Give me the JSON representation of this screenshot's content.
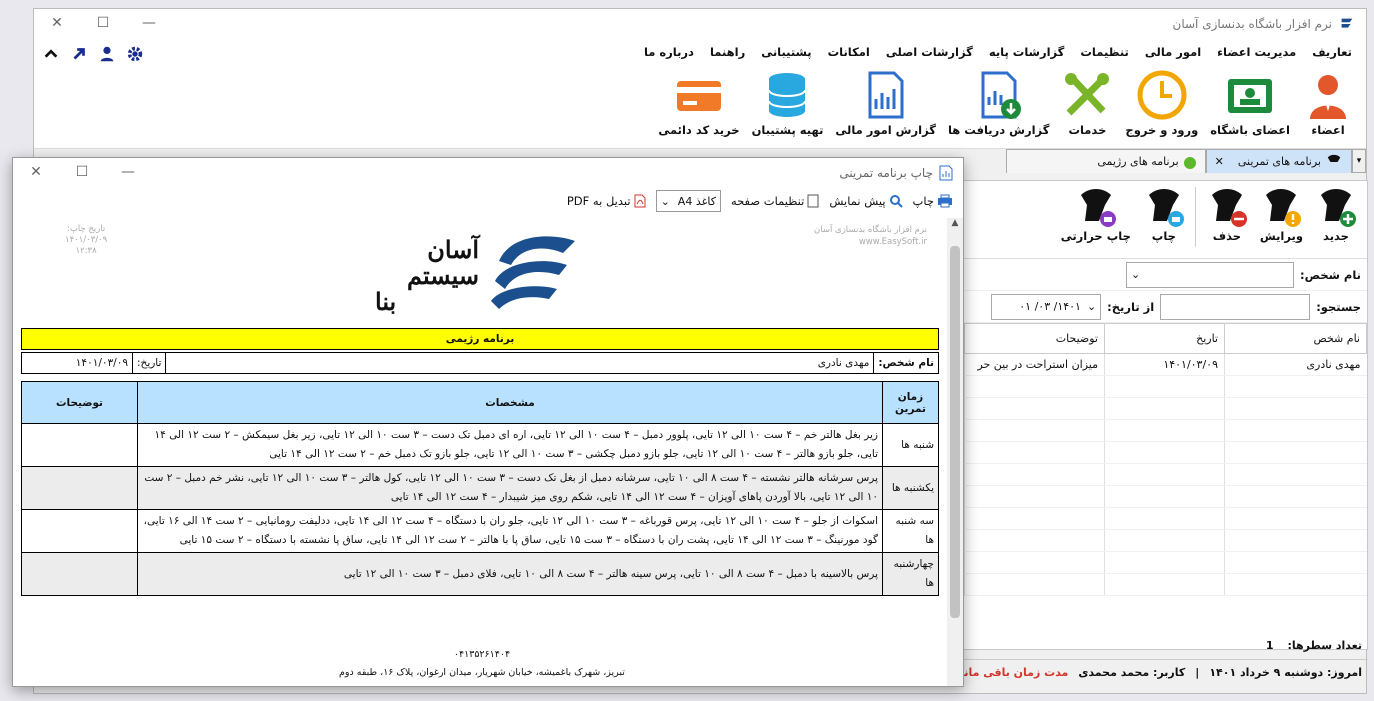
{
  "main": {
    "title": "نرم افزار باشگاه بدنسازی آسان",
    "menu": [
      "تعاریف",
      "مدیریت اعضاء",
      "امور مالی",
      "تنظیمات",
      "گزارشات پایه",
      "گزارشات اصلی",
      "امکانات",
      "پشتیبانی",
      "راهنما",
      "درباره ما"
    ],
    "ribbon": [
      "اعضاء",
      "اعضای باشگاه",
      "ورود و خروج",
      "خدمات",
      "گزارش دریافت ها",
      "گزارش امور مالی",
      "تهیه پشتیبان",
      "خرید کد دائمی"
    ],
    "tabs": {
      "active": "برنامه های تمرینی",
      "other": "برنامه های رژیمی"
    },
    "panel": {
      "buttons": [
        "جدید",
        "ویرایش",
        "حذف",
        "چاپ",
        "چاپ حرارتی"
      ],
      "person_label": "نام شخص:",
      "search_label": "جستجو:",
      "from_date_label": "از تاریخ:",
      "from_date_value": "۱۴۰۱/ ۰۳/ ۰۱",
      "columns": [
        "نام شخص",
        "تاریخ",
        "توضیحات"
      ],
      "rows": [
        [
          "مهدی نادری",
          "۱۴۰۱/۰۳/۰۹",
          "میزان استراحت در بین حر"
        ]
      ],
      "row_count_label": "تعداد سطرها:",
      "row_count_value": "1"
    },
    "status": {
      "today": "امروز: دوشنبه ۹ خرداد ۱۴۰۱",
      "user": "کاربر: محمد محمدی",
      "license": "مدت زمان باقی مانده از اع"
    }
  },
  "print": {
    "title": "چاپ برنامه تمرینی",
    "toolbar": {
      "print": "چاپ",
      "preview": "پیش نمایش",
      "page_settings": "تنظیمات صفحه",
      "paper": "کاغذ A4",
      "pdf": "تبدیل به PDF"
    },
    "doc": {
      "company_line1": "نرم افزار باشگاه بدنسازی آسان",
      "company_line2": "www.EasySoft.ir",
      "print_date_label": "تاریخ چاپ:",
      "print_date": "۱۴۰۱/۰۳/۰۹",
      "print_time": "۱۲:۳۸",
      "logo_text_1": "آسان",
      "logo_text_2": "سیستم",
      "logo_text_3": "بنا",
      "heading": "برنامه رژیمی",
      "person_label": "نام شخص:",
      "person_value": "مهدی نادری",
      "date_label": "تاریخ:",
      "date_value": "۱۴۰۱/۰۳/۰۹",
      "columns": {
        "time": "زمان تمرین",
        "spec": "مشخصات",
        "desc": "توضیحات"
      },
      "rows": [
        {
          "day": "شنبه ها",
          "spec": "زیر بغل هالتر خم – ۴ ست ۱۰ الی ۱۲ تایی، پلوور دمبل – ۴ ست ۱۰ الی ۱۲ تایی، اره ای دمبل تک دست – ۳ ست ۱۰ الی ۱۲ تایی، زیر بغل سیمکش – ۲ ست ۱۲ الی ۱۴ تایی، جلو بازو هالتر – ۴ ست ۱۰ الی ۱۲ تایی، جلو بازو دمبل چکشی – ۳ ست ۱۰ الی ۱۲ تایی، جلو بازو تک دمبل خم – ۲ ست ۱۲ الی ۱۴ تایی"
        },
        {
          "day": "یکشنبه ها",
          "spec": "پرس سرشانه هالتر نشسته – ۴ ست ۸ الی ۱۰ تایی، سرشانه دمبل از بغل تک دست – ۳ ست ۱۰ الی ۱۲ تایی، کول هالتر – ۳ ست ۱۰ الی ۱۲ تایی، نشر خم دمبل – ۲ ست ۱۰ الی ۱۲ تایی، بالا آوردن پاهای آویزان – ۴ ست ۱۲ الی ۱۴ تایی، شکم روی میز شیبدار – ۴ ست ۱۲ الی ۱۴ تایی"
        },
        {
          "day": "سه شنبه ها",
          "spec": "اسکوات از جلو – ۴ ست ۱۰ الی ۱۲ تایی، پرس قورباغه – ۳ ست ۱۰ الی ۱۲ تایی، جلو ران با دستگاه – ۴ ست ۱۲ الی ۱۴ تایی، ددلیفت رومانیایی – ۲ ست ۱۴ الی ۱۶ تایی، گود مورنینگ – ۳ ست ۱۲ الی ۱۴ تایی، پشت ران با دستگاه – ۳ ست ۱۵ تایی، ساق پا با هالتر – ۲ ست ۱۲ الی ۱۴ تایی، ساق پا نشسته با دستگاه – ۲ ست ۱۵ تایی"
        },
        {
          "day": "چهارشنبه ها",
          "spec": "پرس بالاسینه با دمبل – ۴ ست ۸ الی ۱۰ تایی، پرس سینه هالتر – ۴ ست ۸ الی ۱۰ تایی، فلای دمبل – ۳ ست ۱۰ الی ۱۲ تایی"
        }
      ],
      "phone": "۰۴۱۳۵۲۶۱۴۰۴",
      "address": "تبریز، شهرک باغمیشه، خیابان شهریار، میدان ارغوان، پلاک ۱۶، طبقه دوم"
    }
  }
}
